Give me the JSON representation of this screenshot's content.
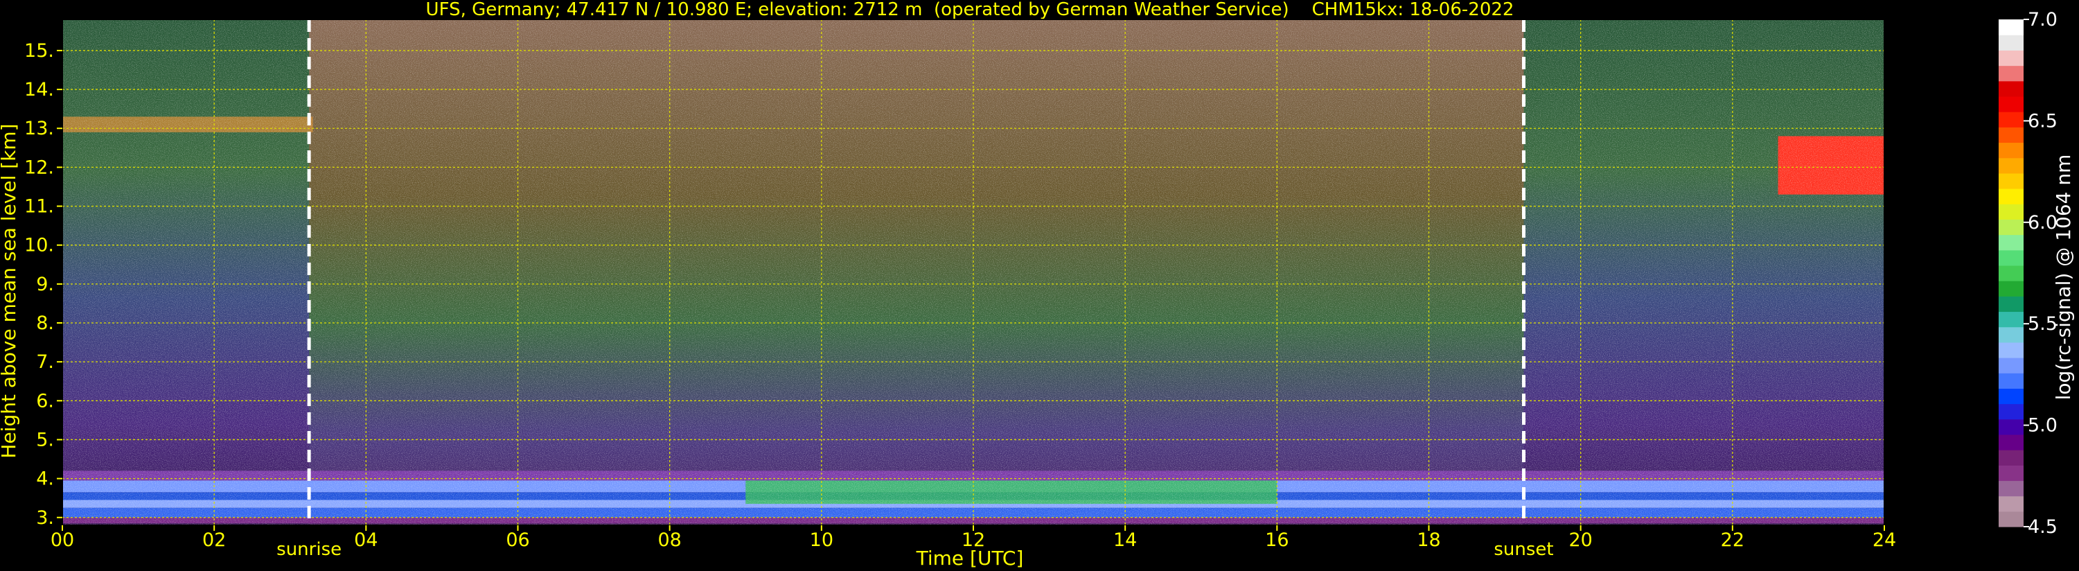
{
  "chart_data": {
    "type": "heatmap",
    "title": "UFS, Germany; 47.417 N / 10.980 E; elevation: 2712 m  (operated by German Weather Service)    CHM15kx: 18-06-2022",
    "xlabel": "Time [UTC]",
    "ylabel": "Height above mean sea level [km]",
    "xlim": [
      0,
      24
    ],
    "ylim": [
      2.8,
      15.8
    ],
    "x_ticks": [
      "00",
      "02",
      "04",
      "06",
      "08",
      "10",
      "12",
      "14",
      "16",
      "18",
      "20",
      "22",
      "24"
    ],
    "y_ticks": [
      "3.",
      "4.",
      "5.",
      "6.",
      "7.",
      "8.",
      "9.",
      "10.",
      "11.",
      "12.",
      "13.",
      "14.",
      "15."
    ],
    "grid": true,
    "events": [
      {
        "label": "sunrise",
        "time": 3.25
      },
      {
        "label": "sunset",
        "time": 19.25
      }
    ],
    "colorbar": {
      "label": "log(rc-signal) @ 1064 nm",
      "range": [
        4.5,
        7.0
      ],
      "ticks": [
        "4.5",
        "5.0",
        "5.5",
        "6.0",
        "6.5",
        "7.0"
      ],
      "colors": [
        "#aa8899",
        "#bb99aa",
        "#996699",
        "#883388",
        "#772277",
        "#660088",
        "#4400aa",
        "#2222dd",
        "#0044ff",
        "#4477ff",
        "#7799ff",
        "#99bbff",
        "#77ccdd",
        "#33bbaa",
        "#119966",
        "#22aa33",
        "#44cc55",
        "#55dd77",
        "#88ee99",
        "#bbf055",
        "#ddf022",
        "#ffee00",
        "#ffcc00",
        "#ffaa00",
        "#ff8800",
        "#ff5500",
        "#ff2200",
        "#ee0000",
        "#dd0000",
        "#ee7777",
        "#f5c0c0",
        "#e8e8e8",
        "#ffffff"
      ]
    },
    "colors": {
      "title": "#ffff00",
      "grid": "#dddd00",
      "event_line": "#ffffff",
      "background": "#000000"
    }
  }
}
